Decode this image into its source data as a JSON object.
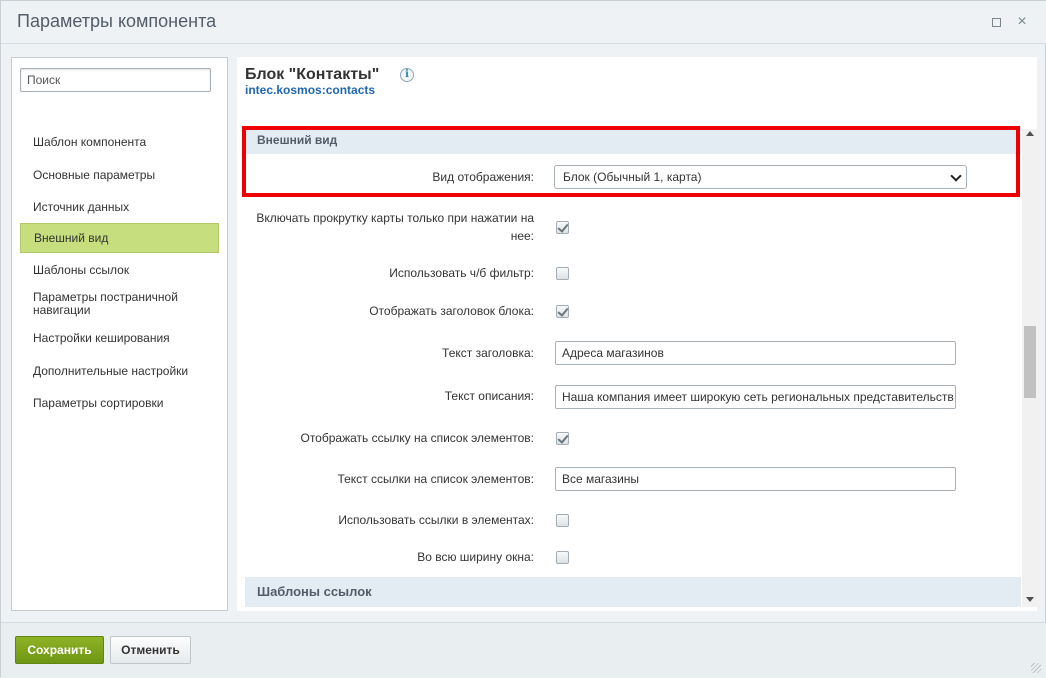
{
  "window": {
    "title": "Параметры компонента"
  },
  "sidebar": {
    "search_placeholder": "Поиск",
    "items": [
      {
        "label": "Шаблон компонента"
      },
      {
        "label": "Основные параметры"
      },
      {
        "label": "Источник данных"
      },
      {
        "label": "Внешний вид",
        "active": true
      },
      {
        "label": "Шаблоны ссылок"
      },
      {
        "label": "Параметры постраничной навигации"
      },
      {
        "label": "Настройки кеширования"
      },
      {
        "label": "Дополнительные настройки"
      },
      {
        "label": "Параметры сортировки"
      }
    ]
  },
  "component": {
    "title": "Блок \"Контакты\"",
    "code": "intec.kosmos:contacts",
    "info_glyph": "i"
  },
  "section_view": {
    "title": "Внешний вид",
    "display_mode": {
      "label": "Вид отображения:",
      "value": "Блок (Обычный 1, карта)"
    },
    "map_scroll": {
      "label": "Включать прокрутку карты только при нажатии на нее:",
      "checked": true
    },
    "bw_filter": {
      "label": "Использовать ч/б фильтр:",
      "checked": false
    },
    "show_header": {
      "label": "Отображать заголовок блока:",
      "checked": true
    },
    "header_text": {
      "label": "Текст заголовка:",
      "value": "Адреса магазинов"
    },
    "description_text": {
      "label": "Текст описания:",
      "value": "Наша компания имеет широкую сеть региональных представительств и"
    },
    "show_list_link": {
      "label": "Отображать ссылку на список элементов:",
      "checked": true
    },
    "list_link_text": {
      "label": "Текст ссылки на список элементов:",
      "value": "Все магазины"
    },
    "use_item_links": {
      "label": "Использовать ссылки в элементах:",
      "checked": false
    },
    "full_width": {
      "label": "Во всю ширину окна:",
      "checked": false
    }
  },
  "section_links": {
    "title": "Шаблоны ссылок"
  },
  "footer": {
    "save_label": "Сохранить",
    "cancel_label": "Отменить"
  },
  "icons": {
    "close": "×"
  },
  "colors": {
    "accent_green": "#c6de7e",
    "save_button": "#7ea21c",
    "highlight": "#ee0000",
    "link_blue": "#2067b0"
  }
}
